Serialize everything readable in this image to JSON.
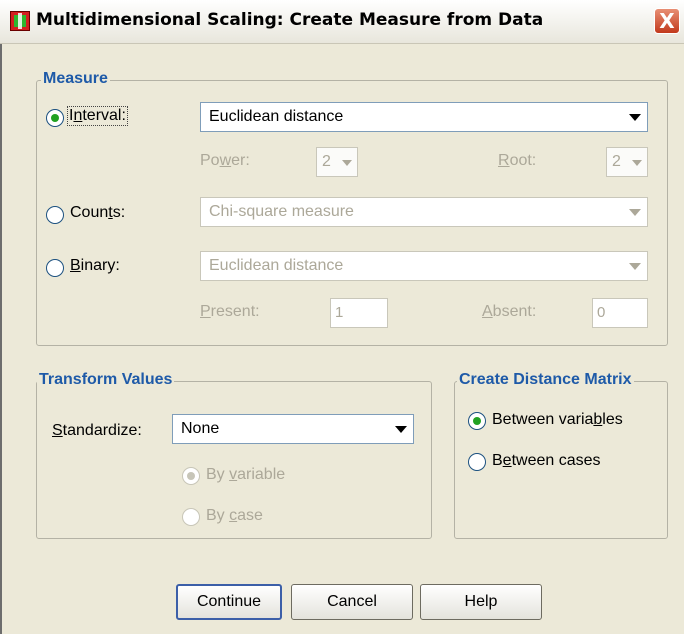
{
  "window": {
    "title": "Multidimensional Scaling: Create Measure from Data",
    "close_label": "X"
  },
  "measure": {
    "legend": "Measure",
    "interval": {
      "label_prefix": "I",
      "label_u": "n",
      "label_rest": "terval:",
      "selected": true,
      "value": "Euclidean distance",
      "power_label_prefix": "Po",
      "power_label_u": "w",
      "power_label_rest": "er:",
      "power_value": "2",
      "root_label_u": "R",
      "root_label_rest": "oot:",
      "root_value": "2"
    },
    "counts": {
      "label_prefix": "Coun",
      "label_u": "t",
      "label_rest": "s:",
      "selected": false,
      "value": "Chi-square measure"
    },
    "binary": {
      "label_u": "B",
      "label_rest": "inary:",
      "selected": false,
      "value": "Euclidean distance",
      "present_label_u": "P",
      "present_label_rest": "resent:",
      "present_value": "1",
      "absent_label_u": "A",
      "absent_label_rest": "bsent:",
      "absent_value": "0"
    }
  },
  "transform": {
    "legend": "Transform Values",
    "standardize_label_u": "S",
    "standardize_label_rest": "tandardize:",
    "standardize_value": "None",
    "by_variable_prefix": "By ",
    "by_variable_u": "v",
    "by_variable_rest": "ariable",
    "by_case_prefix": "By ",
    "by_case_u": "c",
    "by_case_rest": "ase"
  },
  "distance_matrix": {
    "legend": "Create Distance Matrix",
    "between_variables_prefix": "Between varia",
    "between_variables_u": "b",
    "between_variables_rest": "les",
    "between_cases_prefix": "B",
    "between_cases_u": "e",
    "between_cases_rest": "tween cases",
    "selected": "between_variables"
  },
  "buttons": {
    "continue": "Continue",
    "cancel": "Cancel",
    "help": "Help"
  }
}
